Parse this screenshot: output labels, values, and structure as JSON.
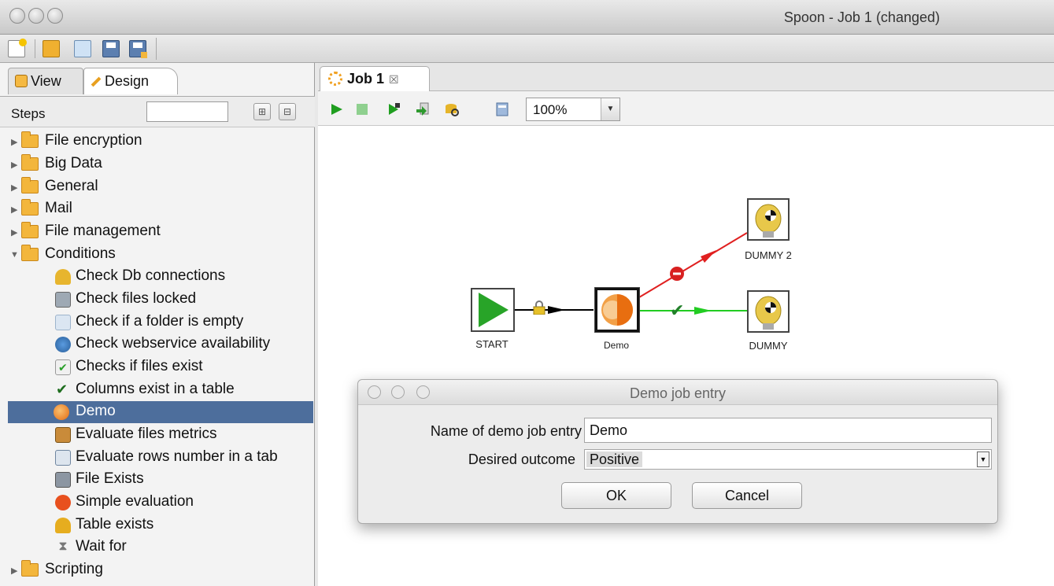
{
  "window": {
    "title": "Spoon - Job 1 (changed)"
  },
  "main_toolbar": {
    "icons": [
      "new-file-icon",
      "open-folder-icon",
      "explore-repository-icon",
      "save-icon",
      "save-as-icon"
    ]
  },
  "left_panel": {
    "tabs": [
      {
        "label": "View",
        "icon": "view-icon"
      },
      {
        "label": "Design",
        "icon": "design-pencil-icon"
      }
    ],
    "steps_label": "Steps",
    "steps_search_value": "",
    "tree": [
      {
        "label": "File encryption",
        "type": "folder",
        "expanded": false
      },
      {
        "label": "Big Data",
        "type": "folder",
        "expanded": false
      },
      {
        "label": "General",
        "type": "folder",
        "expanded": false
      },
      {
        "label": "Mail",
        "type": "folder",
        "expanded": false
      },
      {
        "label": "File management",
        "type": "folder",
        "expanded": false
      },
      {
        "label": "Conditions",
        "type": "folder",
        "expanded": true
      },
      {
        "label": "Check Db connections",
        "type": "step",
        "icon": "db-connection-icon"
      },
      {
        "label": "Check files locked",
        "type": "step",
        "icon": "file-locked-icon"
      },
      {
        "label": "Check if a folder is empty",
        "type": "step",
        "icon": "empty-folder-icon"
      },
      {
        "label": "Check webservice availability",
        "type": "step",
        "icon": "webservice-icon"
      },
      {
        "label": "Checks if files exist",
        "type": "step",
        "icon": "files-exist-icon"
      },
      {
        "label": "Columns exist in a table",
        "type": "step",
        "icon": "columns-check-icon"
      },
      {
        "label": "Demo",
        "type": "step",
        "icon": "demo-icon",
        "selected": true
      },
      {
        "label": "Evaluate files metrics",
        "type": "step",
        "icon": "files-metrics-icon"
      },
      {
        "label": "Evaluate rows number in a tab",
        "type": "step",
        "icon": "rows-number-icon"
      },
      {
        "label": "File Exists",
        "type": "step",
        "icon": "file-exists-icon"
      },
      {
        "label": "Simple evaluation",
        "type": "step",
        "icon": "simple-evaluation-icon"
      },
      {
        "label": "Table exists",
        "type": "step",
        "icon": "table-exists-icon"
      },
      {
        "label": "Wait for",
        "type": "step",
        "icon": "hourglass-icon"
      },
      {
        "label": "Scripting",
        "type": "folder",
        "expanded": false
      }
    ]
  },
  "editor": {
    "tab_label": "Job 1",
    "tab_close": "☒",
    "zoom": "100%",
    "canvas_toolbar_icons": [
      "run-icon",
      "stop-icon",
      "replay-icon",
      "check-icon",
      "impact-icon",
      "sql-icon"
    ]
  },
  "job_canvas": {
    "nodes": [
      {
        "id": "start",
        "label": "START",
        "icon": "start-play-icon"
      },
      {
        "id": "demo",
        "label": "Demo",
        "icon": "demo-icon",
        "selected": true
      },
      {
        "id": "dummy2",
        "label": "DUMMY 2",
        "icon": "dummy-crash-test-icon"
      },
      {
        "id": "dummy",
        "label": "DUMMY",
        "icon": "dummy-crash-test-icon"
      }
    ],
    "hops": [
      {
        "from": "start",
        "to": "demo",
        "type": "unconditional",
        "color": "#000000",
        "icon": "lock-icon"
      },
      {
        "from": "demo",
        "to": "dummy2",
        "type": "failure",
        "color": "#e02020",
        "icon": "failure-icon"
      },
      {
        "from": "demo",
        "to": "dummy",
        "type": "success",
        "color": "#22cc22",
        "icon": "checkmark-icon"
      }
    ]
  },
  "dialog": {
    "title": "Demo job entry",
    "fields": {
      "name_label": "Name of demo job entry",
      "name_value": "Demo",
      "outcome_label": "Desired outcome",
      "outcome_value": "Positive"
    },
    "ok_label": "OK",
    "cancel_label": "Cancel"
  }
}
